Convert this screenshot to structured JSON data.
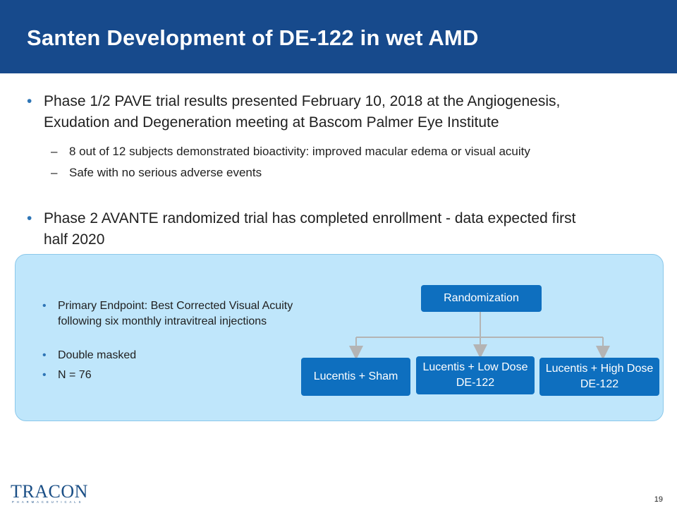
{
  "slide": {
    "title": "Santen Development of DE-122 in wet AMD",
    "page_number": "19"
  },
  "bullets": {
    "b1_line1": "Phase 1/2 PAVE trial results presented February 10, 2018 at the Angiogenesis,",
    "b1_line2": "Exudation and Degeneration meeting at Bascom Palmer Eye Institute",
    "sub1": "8 out of 12 subjects demonstrated bioactivity: improved macular edema or visual acuity",
    "sub2": "Safe with no serious adverse events",
    "b2_line1": "Phase 2 AVANTE randomized trial has completed enrollment - data expected first",
    "b2_line2": "half 2020"
  },
  "panel": {
    "items": [
      "Primary Endpoint: Best Corrected Visual Acuity following six monthly intravitreal injections",
      "Double masked",
      "N = 76"
    ],
    "flow": {
      "root": "Randomization",
      "arm1": "Lucentis + Sham",
      "arm2": "Lucentis + Low Dose DE-122",
      "arm3": "Lucentis + High Dose DE-122"
    }
  },
  "logo": {
    "name": "TRACON",
    "sub": "PHARMACEUTICALS"
  },
  "colors": {
    "header": "#174a8c",
    "accent": "#2e75b6",
    "box": "#0e6fbf",
    "panel": "#bfe6fb"
  }
}
